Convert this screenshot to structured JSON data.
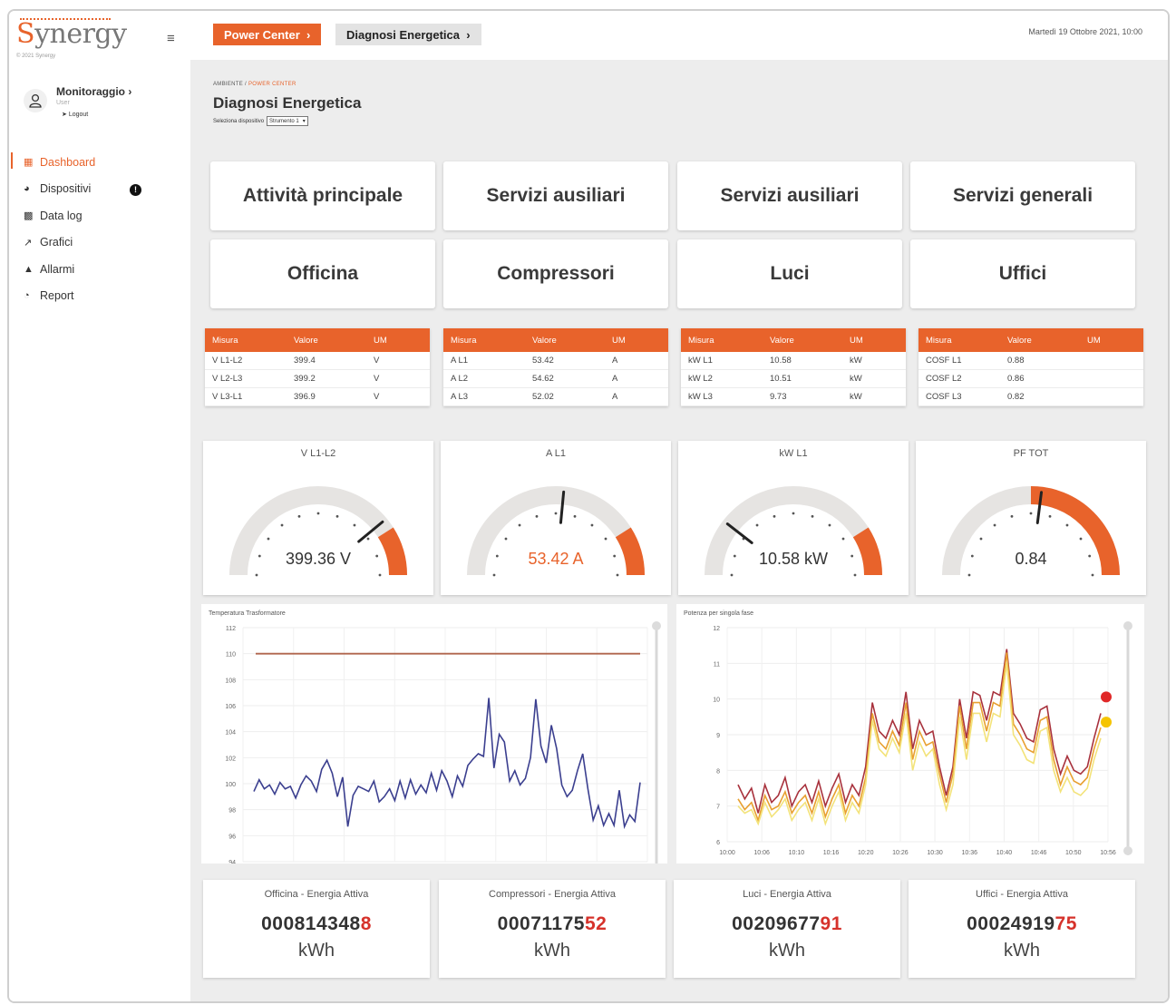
{
  "brand": {
    "name": "Synergy",
    "copyright": "© 2021 Synergy"
  },
  "user": {
    "name": "Monitoraggio",
    "role": "User",
    "logout": "Logout"
  },
  "nav": [
    {
      "label": "Dashboard",
      "icon": "grid-icon",
      "active": true
    },
    {
      "label": "Dispositivi",
      "icon": "dashboard-icon",
      "badge": "!"
    },
    {
      "label": "Data log",
      "icon": "bar-chart-icon"
    },
    {
      "label": "Grafici",
      "icon": "line-chart-icon"
    },
    {
      "label": "Allarmi",
      "icon": "bell-icon"
    },
    {
      "label": "Report",
      "icon": "pie-chart-icon"
    }
  ],
  "topbar": {
    "crumb1": "Power Center",
    "crumb2": "Diagnosi Energetica",
    "datetime": "Martedì 19 Ottobre 2021, 10:00"
  },
  "content": {
    "small_crumb_root": "AMBIENTE",
    "small_crumb_current": "POWER CENTER",
    "title": "Diagnosi Energetica",
    "device_label": "Seleziona dispositivo",
    "device_value": "Strumento 1"
  },
  "tiles": [
    "Attività principale",
    "Servizi ausiliari",
    "Servizi ausiliari",
    "Servizi generali",
    "Officina",
    "Compressori",
    "Luci",
    "Uffici"
  ],
  "tables": [
    {
      "headers": [
        "Misura",
        "Valore",
        "UM"
      ],
      "rows": [
        [
          "V L1-L2",
          "399.4",
          "V"
        ],
        [
          "V L2-L3",
          "399.2",
          "V"
        ],
        [
          "V L3-L1",
          "396.9",
          "V"
        ]
      ]
    },
    {
      "headers": [
        "Misura",
        "Valore",
        "UM"
      ],
      "rows": [
        [
          "A L1",
          "53.42",
          "A"
        ],
        [
          "A L2",
          "54.62",
          "A"
        ],
        [
          "A L3",
          "52.02",
          "A"
        ]
      ]
    },
    {
      "headers": [
        "Misura",
        "Valore",
        "UM"
      ],
      "rows": [
        [
          "kW L1",
          "10.58",
          "kW"
        ],
        [
          "kW L2",
          "10.51",
          "kW"
        ],
        [
          "kW L3",
          "9.73",
          "kW"
        ]
      ]
    },
    {
      "headers": [
        "Misura",
        "Valore",
        "UM"
      ],
      "rows": [
        [
          "COSF L1",
          "0.88",
          ""
        ],
        [
          "COSF L2",
          "0.86",
          ""
        ],
        [
          "COSF L3",
          "0.82",
          ""
        ]
      ]
    }
  ],
  "gauges": [
    {
      "title": "V L1-L2",
      "value_text": "399.36 V",
      "fraction": 0.78,
      "red_from": 0.82,
      "value_color": "#333333"
    },
    {
      "title": "A L1",
      "value_text": "53.42 A",
      "fraction": 0.53,
      "red_from": 0.82,
      "value_color": "#e8632b"
    },
    {
      "title": "kW L1",
      "value_text": "10.58 kW",
      "fraction": 0.21,
      "red_from": 0.82,
      "value_color": "#333333"
    },
    {
      "title": "PF TOT",
      "value_text": "0.84",
      "fraction": 0.54,
      "red_from": 0.5,
      "value_color": "#333333"
    }
  ],
  "chart_data": [
    {
      "type": "line",
      "title": "Temperatura Trasformatore",
      "ylim": [
        94,
        112
      ],
      "yticks": [
        "112",
        "110",
        "108",
        "106",
        "104",
        "102",
        "100",
        "98",
        "96",
        "94"
      ],
      "threshold": 110,
      "series": [
        {
          "values": [
            99.4,
            100.3,
            99.6,
            99.9,
            99.2,
            100.1,
            99.6,
            99.8,
            98.9,
            99.9,
            100.6,
            100.2,
            99.4,
            101.1,
            101.8,
            100.8,
            99.0,
            100.5,
            96.7,
            99.1,
            99.8,
            99.6,
            99.4,
            100.2,
            98.6,
            99.0,
            99.6,
            98.7,
            100.2,
            98.9,
            100.3,
            99.2,
            99.9,
            99.3,
            100.8,
            99.5,
            101.0,
            100.2,
            99.0,
            100.6,
            99.8,
            101.4,
            101.9,
            102.3,
            102.1,
            106.6,
            101.2,
            103.8,
            103.2,
            100.2,
            101.0,
            99.9,
            100.4,
            102.0,
            106.5,
            102.9,
            101.6,
            104.5,
            102.7,
            99.9,
            99.0,
            99.5,
            101.0,
            102.3,
            99.6,
            97.2,
            98.3,
            96.8,
            97.7,
            96.8,
            99.5,
            96.7,
            97.6,
            97.1,
            100.1
          ]
        }
      ]
    },
    {
      "type": "line",
      "title": "Potenza per singola fase",
      "ylim": [
        6,
        12
      ],
      "yticks": [
        "12",
        "11",
        "10",
        "9",
        "8",
        "7",
        "6"
      ],
      "xticks": [
        "10:00",
        "10:06",
        "10:10",
        "10:16",
        "10:20",
        "10:26",
        "10:30",
        "10:36",
        "10:40",
        "10:46",
        "10:50",
        "10:56"
      ],
      "series": [
        {
          "color": "#a8323d",
          "values": [
            7.6,
            7.2,
            7.5,
            6.8,
            7.6,
            7.1,
            7.3,
            7.8,
            7.0,
            7.4,
            7.6,
            7.1,
            7.7,
            7.0,
            7.5,
            7.9,
            7.1,
            7.6,
            7.3,
            8.1,
            9.9,
            9.1,
            8.9,
            9.4,
            9.0,
            10.2,
            8.6,
            9.4,
            9.0,
            9.1,
            8.1,
            7.3,
            8.1,
            10.0,
            8.9,
            10.2,
            10.1,
            9.4,
            10.2,
            10.1,
            11.4,
            9.6,
            9.3,
            8.9,
            8.8,
            9.7,
            9.8,
            8.6,
            7.9,
            8.4,
            8.0,
            7.9,
            8.1,
            8.9,
            9.6
          ]
        },
        {
          "color": "#e8a030",
          "values": [
            7.2,
            6.9,
            7.1,
            6.6,
            7.3,
            6.9,
            7.0,
            7.4,
            6.8,
            7.1,
            7.3,
            6.8,
            7.4,
            6.7,
            7.2,
            7.6,
            6.8,
            7.3,
            7.0,
            7.8,
            9.6,
            8.8,
            8.6,
            9.1,
            8.7,
            9.9,
            8.3,
            9.1,
            8.7,
            8.8,
            7.9,
            7.1,
            7.9,
            9.8,
            8.6,
            9.9,
            9.9,
            9.1,
            9.9,
            9.8,
            11.3,
            9.3,
            9.0,
            8.6,
            8.5,
            9.4,
            9.5,
            8.3,
            7.6,
            8.1,
            7.7,
            7.6,
            7.8,
            8.6,
            9.2
          ]
        },
        {
          "color": "#f3e37a",
          "values": [
            7.0,
            6.8,
            6.9,
            6.5,
            7.1,
            6.7,
            6.9,
            7.2,
            6.6,
            6.9,
            7.1,
            6.6,
            7.2,
            6.5,
            7.0,
            7.4,
            6.6,
            7.1,
            6.8,
            7.6,
            9.4,
            8.6,
            8.4,
            8.9,
            8.5,
            9.6,
            8.0,
            8.8,
            8.4,
            8.6,
            7.6,
            6.9,
            7.6,
            9.5,
            8.3,
            9.6,
            9.6,
            8.8,
            9.6,
            9.5,
            11.0,
            9.0,
            8.7,
            8.3,
            8.2,
            9.1,
            9.2,
            8.0,
            7.4,
            7.8,
            7.4,
            7.3,
            7.5,
            8.3,
            8.9
          ]
        }
      ]
    }
  ],
  "energy": [
    {
      "title": "Officina - Energia Attiva",
      "value_main": "000814348",
      "value_red": "8",
      "unit": "kWh"
    },
    {
      "title": "Compressori - Energia Attiva",
      "value_main": "00071175",
      "value_red": "52",
      "unit": "kWh"
    },
    {
      "title": "Luci - Energia Attiva",
      "value_main": "00209677",
      "value_red": "91",
      "unit": "kWh"
    },
    {
      "title": "Uffici - Energia Attiva",
      "value_main": "00024919",
      "value_red": "75",
      "unit": "kWh"
    }
  ],
  "colors": {
    "accent": "#e8632b",
    "background": "#ededed",
    "gauge_track": "#e6e4e2",
    "gauge_red": "#e8632b"
  }
}
